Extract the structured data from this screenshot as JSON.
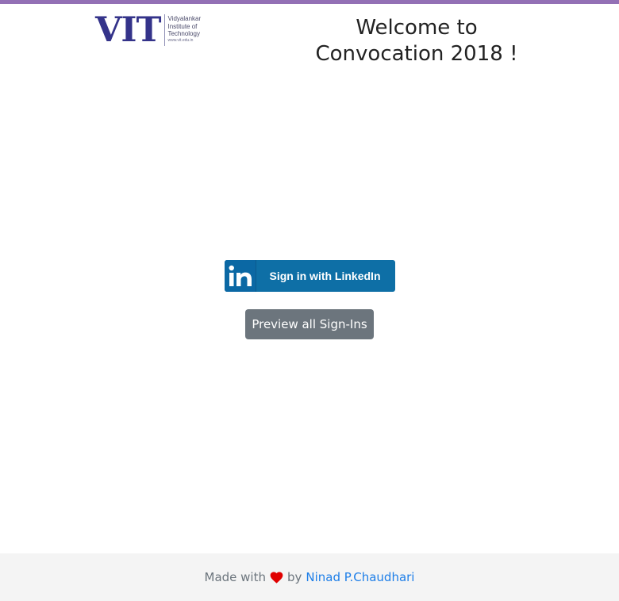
{
  "header": {
    "logo": {
      "mark": "VIT",
      "line1": "Vidyalankar",
      "line2": "Institute of",
      "line3": "Technology",
      "url": "www.vit.edu.in"
    },
    "welcome_line1": "Welcome to",
    "welcome_line2": "Convocation 2018 !"
  },
  "main": {
    "linkedin_button_label": "Sign in with LinkedIn",
    "linkedin_icon": "linkedin-icon",
    "preview_button_label": "Preview all Sign-Ins"
  },
  "footer": {
    "made_with": "Made with",
    "heart_icon": "heart-icon",
    "by": "by",
    "author_link": "Ninad P.Chaudhari"
  },
  "colors": {
    "accent_bar": "#9370b5",
    "linkedin_blue": "#0e6fa6",
    "secondary_button": "#6c757d",
    "heart": "#e00000",
    "link": "#1d7ee8",
    "footer_bg": "#f4f4f4",
    "logo_navy": "#34338a"
  }
}
